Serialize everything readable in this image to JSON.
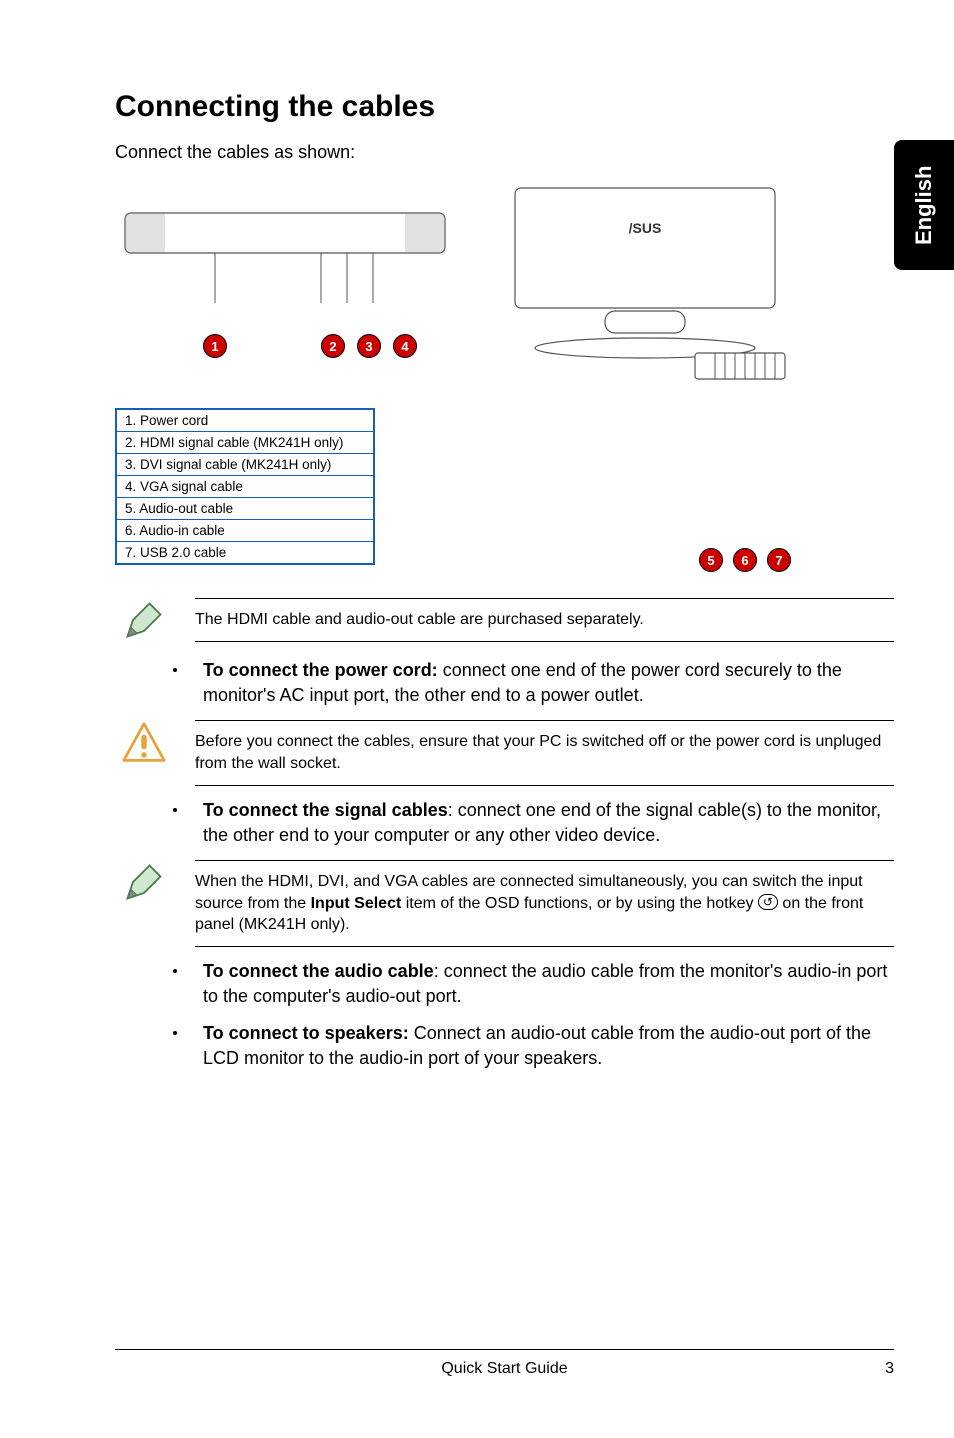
{
  "side_tab": "English",
  "heading": "Connecting the cables",
  "intro": "Connect the cables as shown:",
  "callouts_left": [
    "1",
    "2",
    "3",
    "4"
  ],
  "callouts_right": [
    "5",
    "6",
    "7"
  ],
  "legend": {
    "r1": "1. Power cord",
    "r2": "2. HDMI signal cable (MK241H only)",
    "r3": "3. DVI signal cable (MK241H only)",
    "r4": "4. VGA signal cable",
    "r5": "5. Audio-out cable",
    "r6": "6. Audio-in cable",
    "r7": "7. USB 2.0 cable"
  },
  "note1": "The HDMI cable and audio-out cable are purchased separately.",
  "bullet1_bold": "To connect the power cord:",
  "bullet1_rest": " connect one end of the power cord securely to the monitor's AC input port, the other end to a power outlet.",
  "warn1": "Before you connect the cables, ensure that your PC is switched off or the power cord is unpluged from the wall socket.",
  "bullet2_bold": "To connect the signal cables",
  "bullet2_rest": ": connect one end of the signal cable(s) to the monitor, the other end to your computer or any other video device.",
  "note2_a": "When the HDMI, DVI, and VGA cables are connected simultaneously, you can switch the input source from the ",
  "note2_bold": "Input Select",
  "note2_b": " item of the OSD functions, or by using the hotkey ",
  "note2_c": " on the front panel (MK241H only).",
  "bullet3_bold": "To connect the audio cable",
  "bullet3_rest": ": connect the audio cable from the monitor's audio-in port to the computer's audio-out port.",
  "bullet4_bold": "To connect to speakers:",
  "bullet4_rest": " Connect an audio-out cable from the audio-out port of the LCD monitor to the audio-in port of your speakers.",
  "footer_center": "Quick Start Guide",
  "footer_page": "3"
}
